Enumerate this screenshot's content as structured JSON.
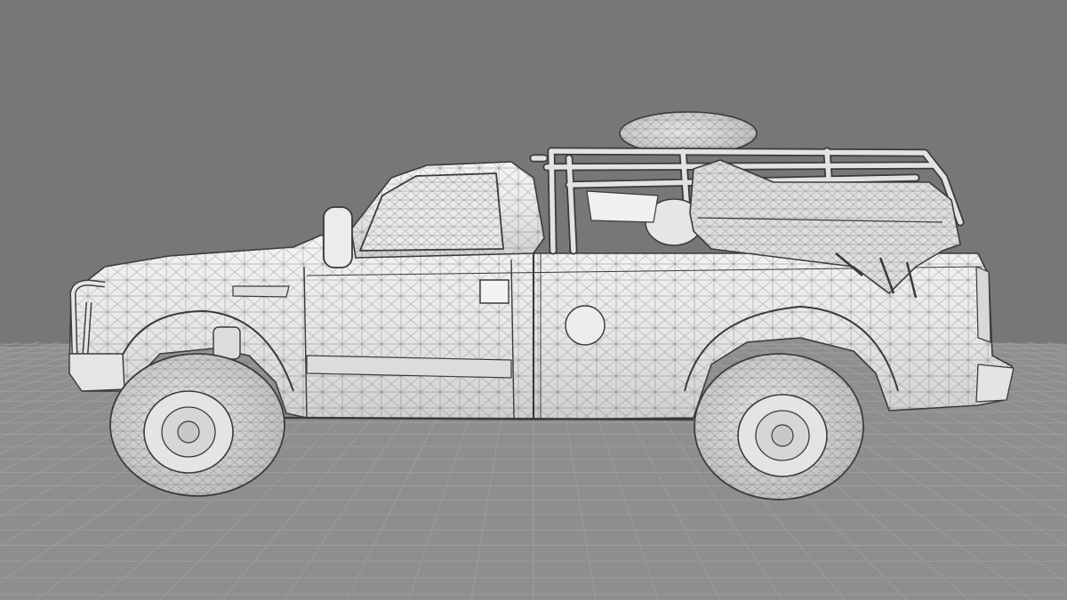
{
  "viewport": {
    "background_color": "#777777",
    "floor_color": "#8e8e8e",
    "grid_line_color": "#a2a2a2",
    "horizon_color": "#9a9a9a"
  },
  "model": {
    "render_style": "wireframe-on-shaded",
    "surface_color": "#ececec",
    "shadow_color": "#bdbdbd",
    "wire_color": "#555555",
    "outline_color": "#3a3a3a",
    "tire_color": "#d2d2d2",
    "icons": [
      "pickup-truck-model",
      "spare-tire",
      "roll-cage",
      "bull-bar",
      "cargo-tarp"
    ]
  }
}
